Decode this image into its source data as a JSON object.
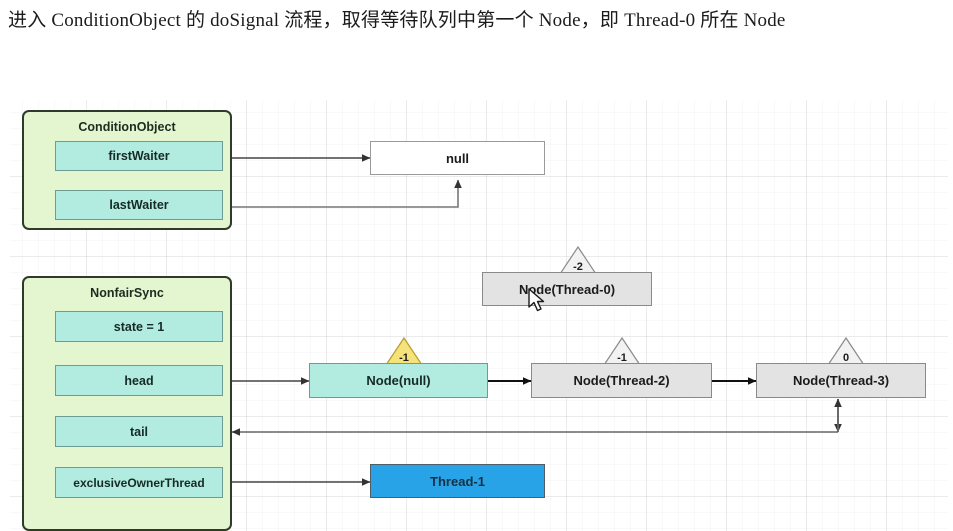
{
  "caption": "进入 ConditionObject 的 doSignal 流程，取得等待队列中第一个 Node，即 Thread-0 所在 Node",
  "colors": {
    "group_fill": "#e4f6d0",
    "group_border": "#2e3b2a",
    "field_fill": "#b2ece0",
    "node_gray_fill": "#e3e3e3",
    "node_white_fill": "#ffffff",
    "node_blue_fill": "#29a3e8",
    "triangle_yellow": "#f5e27a",
    "triangle_gray": "#f0f0f0",
    "edge": "#5a5a5a"
  },
  "diagram": {
    "groups": [
      {
        "id": "condition-object",
        "title": "ConditionObject",
        "fields": [
          {
            "id": "firstWaiter",
            "label": "firstWaiter"
          },
          {
            "id": "lastWaiter",
            "label": "lastWaiter"
          }
        ]
      },
      {
        "id": "nonfair-sync",
        "title": "NonfairSync",
        "fields": [
          {
            "id": "state",
            "label": "state = 1"
          },
          {
            "id": "head",
            "label": "head"
          },
          {
            "id": "tail",
            "label": "tail"
          },
          {
            "id": "exclusiveOwnerThread",
            "label": "exclusiveOwnerThread"
          }
        ]
      }
    ],
    "nodes": [
      {
        "id": "null-box",
        "label": "null",
        "style": "white",
        "waitstatus": null
      },
      {
        "id": "node-thread-0",
        "label": "Node(Thread-0)",
        "style": "gray",
        "waitstatus": "-2"
      },
      {
        "id": "node-null",
        "label": "Node(null)",
        "style": "mint",
        "waitstatus": "-1"
      },
      {
        "id": "node-thread-2",
        "label": "Node(Thread-2)",
        "style": "gray",
        "waitstatus": "-1"
      },
      {
        "id": "node-thread-3",
        "label": "Node(Thread-3)",
        "style": "gray",
        "waitstatus": "0"
      },
      {
        "id": "thread-1",
        "label": "Thread-1",
        "style": "blue",
        "waitstatus": null
      }
    ]
  }
}
